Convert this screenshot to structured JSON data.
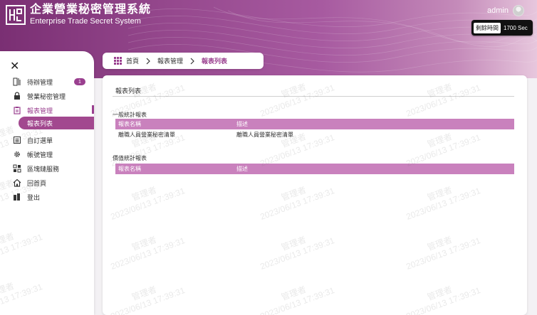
{
  "header": {
    "title_cn": "企業營業秘密管理系統",
    "title_en": "Enterprise Trade Secret System",
    "user": "admin",
    "timer_label": "剩餘時間",
    "timer_value": "1700 Sec"
  },
  "sidebar": {
    "close_icon": "close-icon",
    "items": [
      {
        "label": "待辦管理",
        "icon": "todo-icon",
        "badge": "1"
      },
      {
        "label": "營業秘密管理",
        "icon": "lock-icon"
      },
      {
        "label": "報表管理",
        "icon": "clipboard-icon"
      },
      {
        "label": "報表列表"
      },
      {
        "label": "自訂選單",
        "icon": "menu-icon"
      },
      {
        "label": "帳號管理",
        "icon": "gear-icon"
      },
      {
        "label": "區塊鏈服務",
        "icon": "blockchain-icon"
      },
      {
        "label": "回首頁",
        "icon": "home-icon"
      },
      {
        "label": "登出",
        "icon": "logout-icon"
      }
    ]
  },
  "breadcrumb": {
    "home": "首頁",
    "level2": "報表管理",
    "current": "報表列表"
  },
  "main": {
    "title": "報表列表",
    "sections": [
      {
        "title": "一般統計報表",
        "columns": [
          "報表名稱",
          "描述"
        ],
        "rows": [
          [
            "離職人員營業秘密清單",
            "離職人員營業秘密清單"
          ]
        ]
      },
      {
        "title": "價值統計報表",
        "columns": [
          "報表名稱",
          "描述"
        ],
        "rows": []
      }
    ]
  },
  "watermark": {
    "name": "管理者",
    "datetime": "2023/06/13 17:39:31"
  },
  "colors": {
    "accent": "#9a3f8f",
    "table_header": "#c981bd",
    "header_start": "#7a2f73",
    "header_end": "#e7c7dd"
  }
}
